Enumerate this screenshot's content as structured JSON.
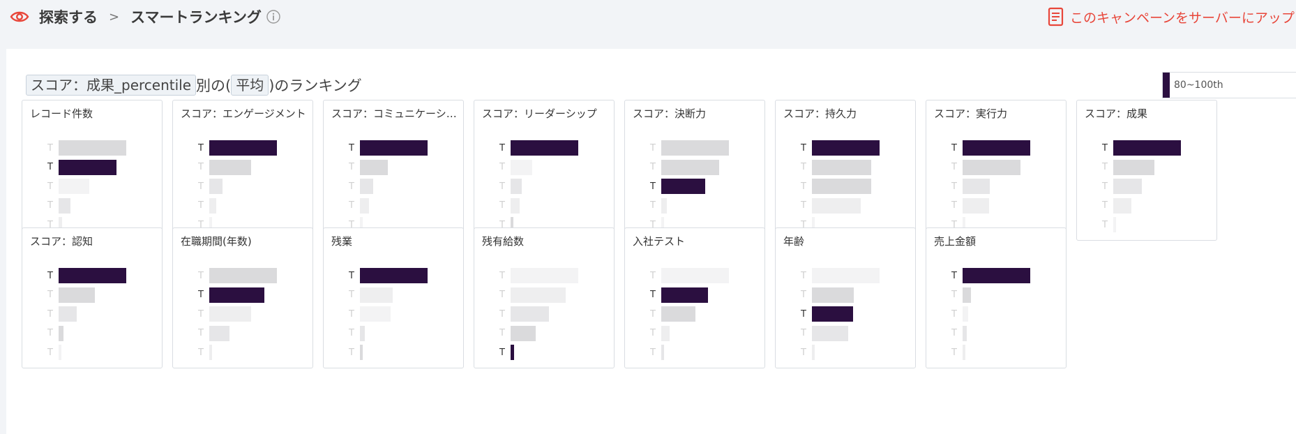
{
  "header": {
    "breadcrumb": [
      {
        "label": "探索する"
      },
      {
        "label": "スマートランキング"
      }
    ],
    "separator": ">",
    "upload_label": "このキャンペーンをサーバーにアップロ",
    "accent_color": "#e8463a"
  },
  "headline": {
    "metric_pill": "スコア：成果_percentile",
    "middle_text": "別の(",
    "agg_pill": "平均",
    "end_text": ")のランキング"
  },
  "legend": {
    "label": "80~100th",
    "color": "#2b0f40"
  },
  "bar_colors": {
    "highlight": "#2b0f40",
    "gray": [
      "#d3d3d6",
      "#dadadc",
      "#e6e6e8",
      "#eeeeef",
      "#f3f3f4"
    ]
  },
  "cards": [
    {
      "title": "レコード件数",
      "bars": [
        {
          "v": 1.0,
          "s": 1,
          "a": false
        },
        {
          "v": 0.86,
          "s": 0,
          "a": true
        },
        {
          "v": 0.45,
          "s": 4,
          "a": false
        },
        {
          "v": 0.18,
          "s": 2,
          "a": false
        },
        {
          "v": 0.05,
          "s": 3,
          "a": false
        }
      ]
    },
    {
      "title": "スコア：エンゲージメント",
      "bars": [
        {
          "v": 1.0,
          "s": 0,
          "a": true
        },
        {
          "v": 0.62,
          "s": 1,
          "a": false
        },
        {
          "v": 0.2,
          "s": 2,
          "a": false
        },
        {
          "v": 0.1,
          "s": 3,
          "a": false
        },
        {
          "v": 0.04,
          "s": 4,
          "a": false
        }
      ]
    },
    {
      "title": "スコア：コミュニケーション",
      "bars": [
        {
          "v": 1.0,
          "s": 0,
          "a": true
        },
        {
          "v": 0.41,
          "s": 1,
          "a": false
        },
        {
          "v": 0.2,
          "s": 2,
          "a": false
        },
        {
          "v": 0.13,
          "s": 3,
          "a": false
        },
        {
          "v": 0.04,
          "s": 4,
          "a": false
        }
      ]
    },
    {
      "title": "スコア：リーダーシップ",
      "bars": [
        {
          "v": 1.0,
          "s": 0,
          "a": true
        },
        {
          "v": 0.32,
          "s": 4,
          "a": false
        },
        {
          "v": 0.16,
          "s": 2,
          "a": false
        },
        {
          "v": 0.13,
          "s": 3,
          "a": false
        },
        {
          "v": 0.04,
          "s": 1,
          "a": false
        }
      ]
    },
    {
      "title": "スコア：決断力",
      "bars": [
        {
          "v": 1.0,
          "s": 1,
          "a": false
        },
        {
          "v": 0.86,
          "s": 1,
          "a": false
        },
        {
          "v": 0.65,
          "s": 0,
          "a": true
        },
        {
          "v": 0.08,
          "s": 3,
          "a": false
        },
        {
          "v": 0.04,
          "s": 4,
          "a": false
        }
      ]
    },
    {
      "title": "スコア：持久力",
      "bars": [
        {
          "v": 1.0,
          "s": 0,
          "a": true
        },
        {
          "v": 0.88,
          "s": 1,
          "a": false
        },
        {
          "v": 0.88,
          "s": 1,
          "a": false
        },
        {
          "v": 0.72,
          "s": 3,
          "a": false
        },
        {
          "v": 0.04,
          "s": 4,
          "a": false
        }
      ]
    },
    {
      "title": "スコア：実行力",
      "bars": [
        {
          "v": 1.0,
          "s": 0,
          "a": true
        },
        {
          "v": 0.86,
          "s": 1,
          "a": false
        },
        {
          "v": 0.4,
          "s": 2,
          "a": false
        },
        {
          "v": 0.39,
          "s": 3,
          "a": false
        },
        {
          "v": 0.04,
          "s": 4,
          "a": false
        }
      ]
    },
    {
      "title": "スコア：成果",
      "bars": [
        {
          "v": 1.0,
          "s": 0,
          "a": true
        },
        {
          "v": 0.61,
          "s": 1,
          "a": false
        },
        {
          "v": 0.42,
          "s": 2,
          "a": false
        },
        {
          "v": 0.27,
          "s": 3,
          "a": false
        },
        {
          "v": 0.04,
          "s": 4,
          "a": false
        }
      ]
    },
    {
      "title": "スコア：認知",
      "bars": [
        {
          "v": 1.0,
          "s": 0,
          "a": true
        },
        {
          "v": 0.54,
          "s": 1,
          "a": false
        },
        {
          "v": 0.27,
          "s": 2,
          "a": false
        },
        {
          "v": 0.07,
          "s": 1,
          "a": false
        },
        {
          "v": 0.04,
          "s": 4,
          "a": false
        }
      ]
    },
    {
      "title": "在職期間(年数)",
      "bars": [
        {
          "v": 1.0,
          "s": 1,
          "a": false
        },
        {
          "v": 0.81,
          "s": 0,
          "a": true
        },
        {
          "v": 0.62,
          "s": 3,
          "a": false
        },
        {
          "v": 0.3,
          "s": 2,
          "a": false
        },
        {
          "v": 0.04,
          "s": 3,
          "a": false
        }
      ]
    },
    {
      "title": "残業",
      "bars": [
        {
          "v": 1.0,
          "s": 0,
          "a": true
        },
        {
          "v": 0.48,
          "s": 3,
          "a": false
        },
        {
          "v": 0.45,
          "s": 4,
          "a": false
        },
        {
          "v": 0.07,
          "s": 2,
          "a": false
        },
        {
          "v": 0.04,
          "s": 1,
          "a": false
        }
      ]
    },
    {
      "title": "残有給数",
      "bars": [
        {
          "v": 1.0,
          "s": 4,
          "a": false
        },
        {
          "v": 0.81,
          "s": 3,
          "a": false
        },
        {
          "v": 0.57,
          "s": 2,
          "a": false
        },
        {
          "v": 0.37,
          "s": 1,
          "a": false
        },
        {
          "v": 0.05,
          "s": 0,
          "a": true
        }
      ]
    },
    {
      "title": "入社テスト",
      "bars": [
        {
          "v": 1.0,
          "s": 4,
          "a": false
        },
        {
          "v": 0.69,
          "s": 0,
          "a": true
        },
        {
          "v": 0.5,
          "s": 1,
          "a": false
        },
        {
          "v": 0.12,
          "s": 3,
          "a": false
        },
        {
          "v": 0.04,
          "s": 2,
          "a": false
        }
      ]
    },
    {
      "title": "年齢",
      "bars": [
        {
          "v": 1.0,
          "s": 4,
          "a": false
        },
        {
          "v": 0.62,
          "s": 1,
          "a": false
        },
        {
          "v": 0.61,
          "s": 0,
          "a": true
        },
        {
          "v": 0.54,
          "s": 2,
          "a": false
        },
        {
          "v": 0.04,
          "s": 3,
          "a": false
        }
      ]
    },
    {
      "title": "売上金額",
      "bars": [
        {
          "v": 1.0,
          "s": 0,
          "a": true
        },
        {
          "v": 0.12,
          "s": 1,
          "a": false
        },
        {
          "v": 0.08,
          "s": 4,
          "a": false
        },
        {
          "v": 0.06,
          "s": 2,
          "a": false
        },
        {
          "v": 0.04,
          "s": 3,
          "a": false
        }
      ]
    }
  ],
  "tick_label": "T"
}
